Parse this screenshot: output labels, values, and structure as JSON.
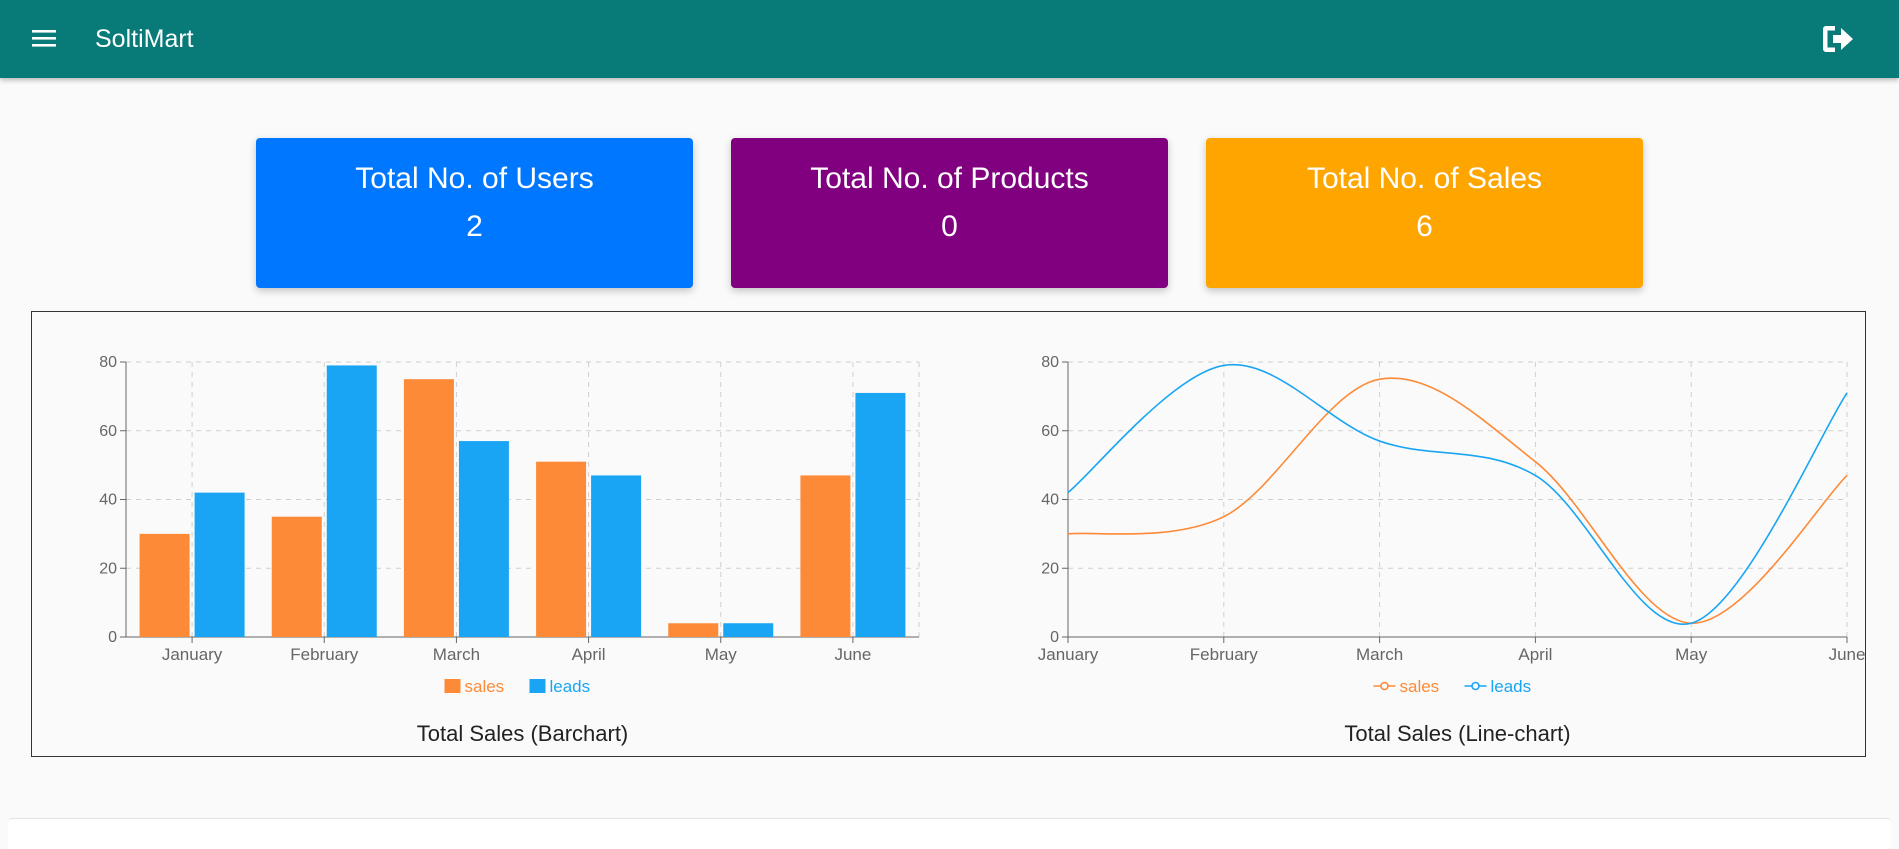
{
  "header": {
    "title": "SoltiMart",
    "menu_icon": "menu-icon",
    "logout_icon": "logout-icon",
    "background": "#087a78"
  },
  "stats": {
    "users": {
      "title": "Total No. of Users",
      "value": "2",
      "color": "#0077ff"
    },
    "products": {
      "title": "Total No. of Products",
      "value": "0",
      "color": "#800080"
    },
    "sales": {
      "title": "Total No. of Sales",
      "value": "6",
      "color": "#ffa500"
    }
  },
  "chart_data": [
    {
      "type": "bar",
      "title": "Total Sales (Barchart)",
      "categories": [
        "January",
        "February",
        "March",
        "April",
        "May",
        "June"
      ],
      "series": [
        {
          "name": "sales",
          "values": [
            30,
            35,
            75,
            51,
            4,
            47
          ],
          "color": "#fd8a37"
        },
        {
          "name": "leads",
          "values": [
            42,
            79,
            57,
            47,
            4,
            71
          ],
          "color": "#19a5f3"
        }
      ],
      "ylim": [
        0,
        80
      ],
      "yticks": [
        "0",
        "20",
        "40",
        "60",
        "80"
      ],
      "grid": true,
      "legend": "bottom-center"
    },
    {
      "type": "line",
      "title": "Total Sales (Line-chart)",
      "categories": [
        "January",
        "February",
        "March",
        "April",
        "May",
        "June"
      ],
      "series": [
        {
          "name": "sales",
          "values": [
            30,
            35,
            75,
            51,
            4,
            47
          ],
          "color": "#fd8a37"
        },
        {
          "name": "leads",
          "values": [
            42,
            79,
            57,
            47,
            4,
            71
          ],
          "color": "#19a5f3"
        }
      ],
      "ylim": [
        0,
        80
      ],
      "yticks": [
        "0",
        "20",
        "40",
        "60",
        "80"
      ],
      "grid": true,
      "legend": "bottom-center"
    }
  ]
}
